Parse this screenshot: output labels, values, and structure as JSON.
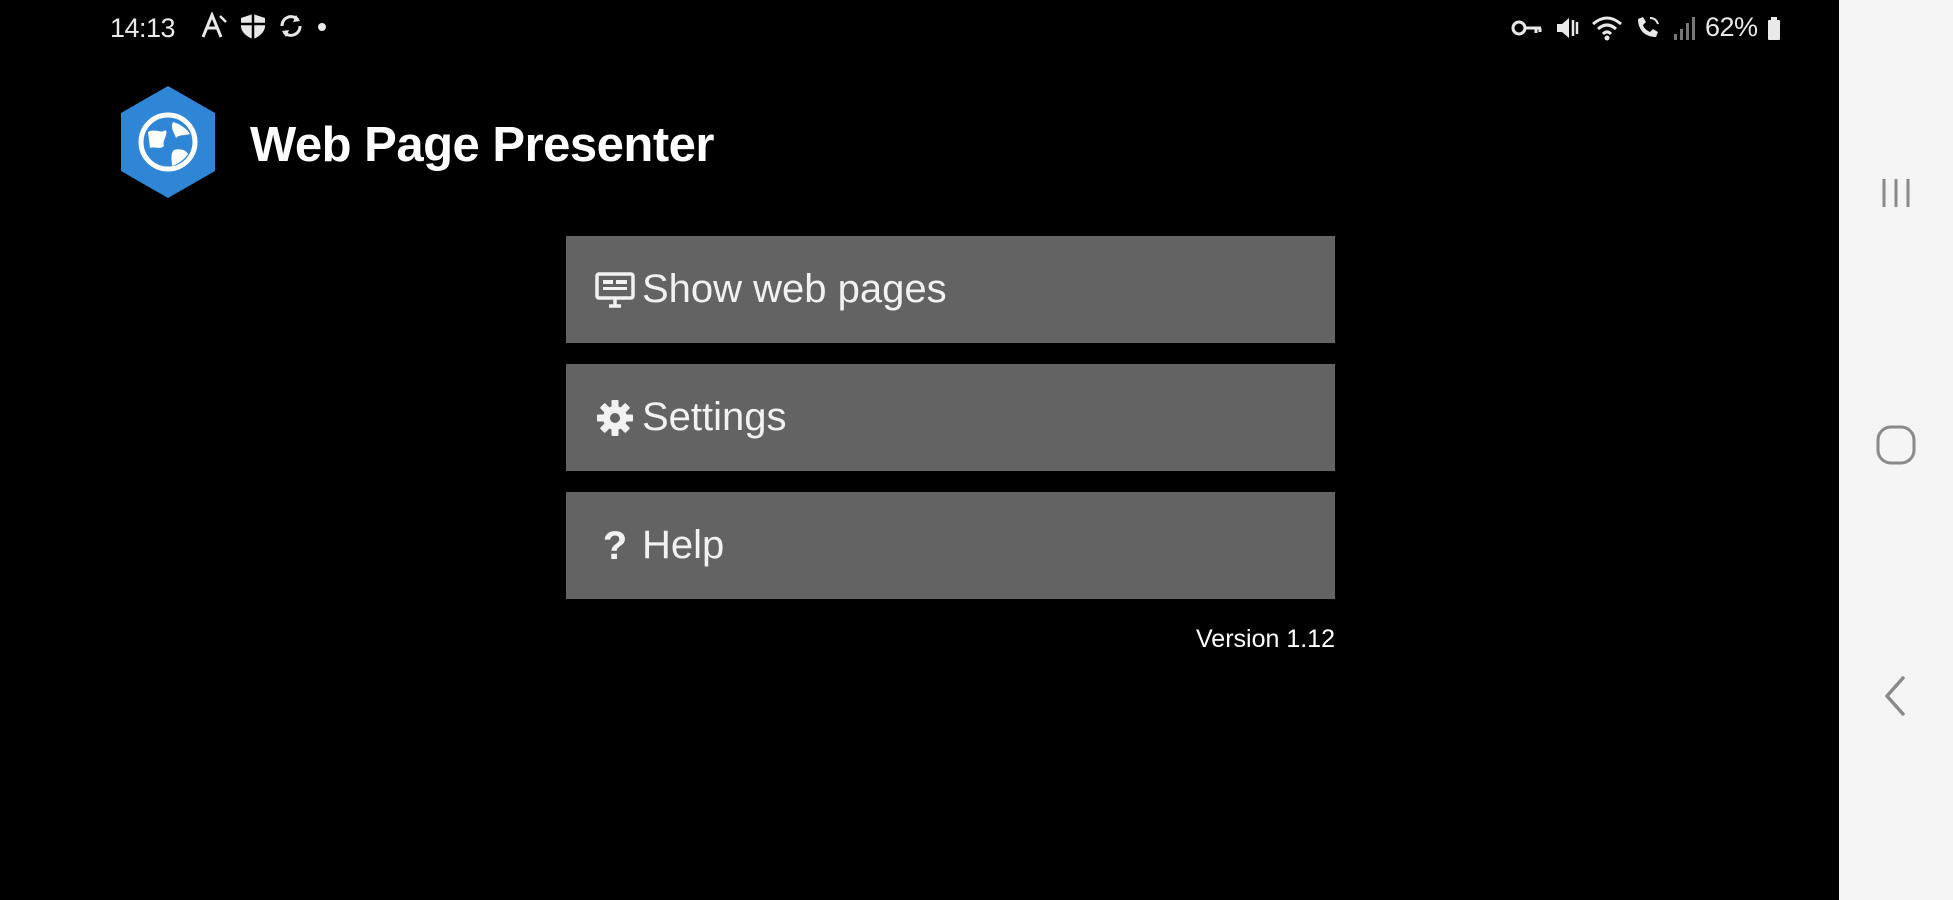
{
  "status_bar": {
    "time": "14:13",
    "left_icons": [
      "font-a-icon",
      "shield-icon",
      "sync-icon",
      "dot-icon"
    ],
    "right_icons": [
      "key-icon",
      "mute-icon",
      "wifi-icon",
      "wifi-call-icon",
      "signal-icon"
    ],
    "battery": "62%"
  },
  "app": {
    "title": "Web Page Presenter",
    "logo_icon": "globe-hexagon-icon",
    "accent_color": "#2f86d6"
  },
  "menu": {
    "items": [
      {
        "label": "Show web pages",
        "icon": "monitor-icon"
      },
      {
        "label": "Settings",
        "icon": "gear-icon"
      },
      {
        "label": "Help",
        "icon": "question-icon",
        "glyph": "?"
      }
    ],
    "button_color": "#636363"
  },
  "version": "Version 1.12",
  "nav_bar": {
    "buttons": [
      "recents-icon",
      "home-icon",
      "back-icon"
    ]
  }
}
